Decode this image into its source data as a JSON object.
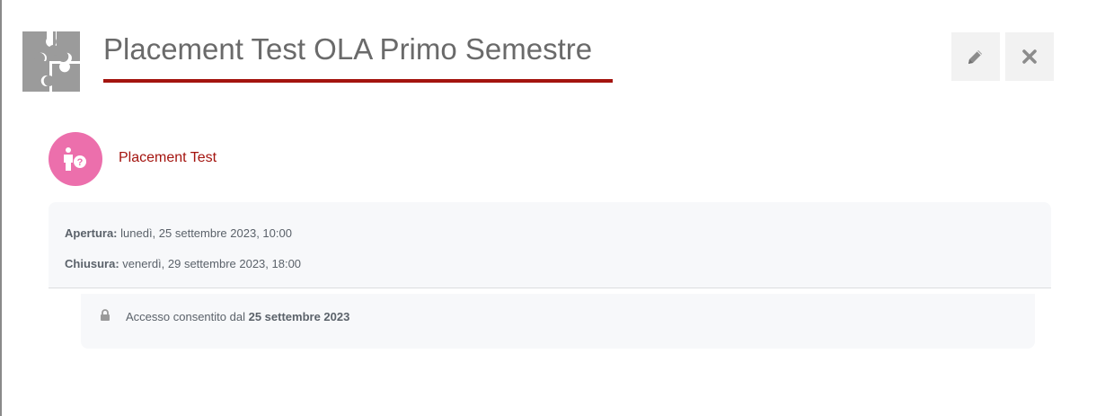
{
  "header": {
    "title": "Placement Test OLA Primo Semestre",
    "puzzle_icon": "puzzle-icon",
    "accent_color": "#a4140f"
  },
  "actions": {
    "edit_icon": "pencil-icon",
    "close_icon": "close-icon"
  },
  "activity": {
    "icon": "person-question-icon",
    "icon_color": "#ec6fac",
    "name": "Placement Test"
  },
  "dates": {
    "open_label": "Apertura:",
    "open_value": "lunedì, 25 settembre 2023, 10:00",
    "close_label": "Chiusura:",
    "close_value": "venerdì, 29 settembre 2023, 18:00"
  },
  "restriction": {
    "icon": "lock-icon",
    "text": "Accesso consentito dal",
    "date": "25 settembre 2023"
  }
}
